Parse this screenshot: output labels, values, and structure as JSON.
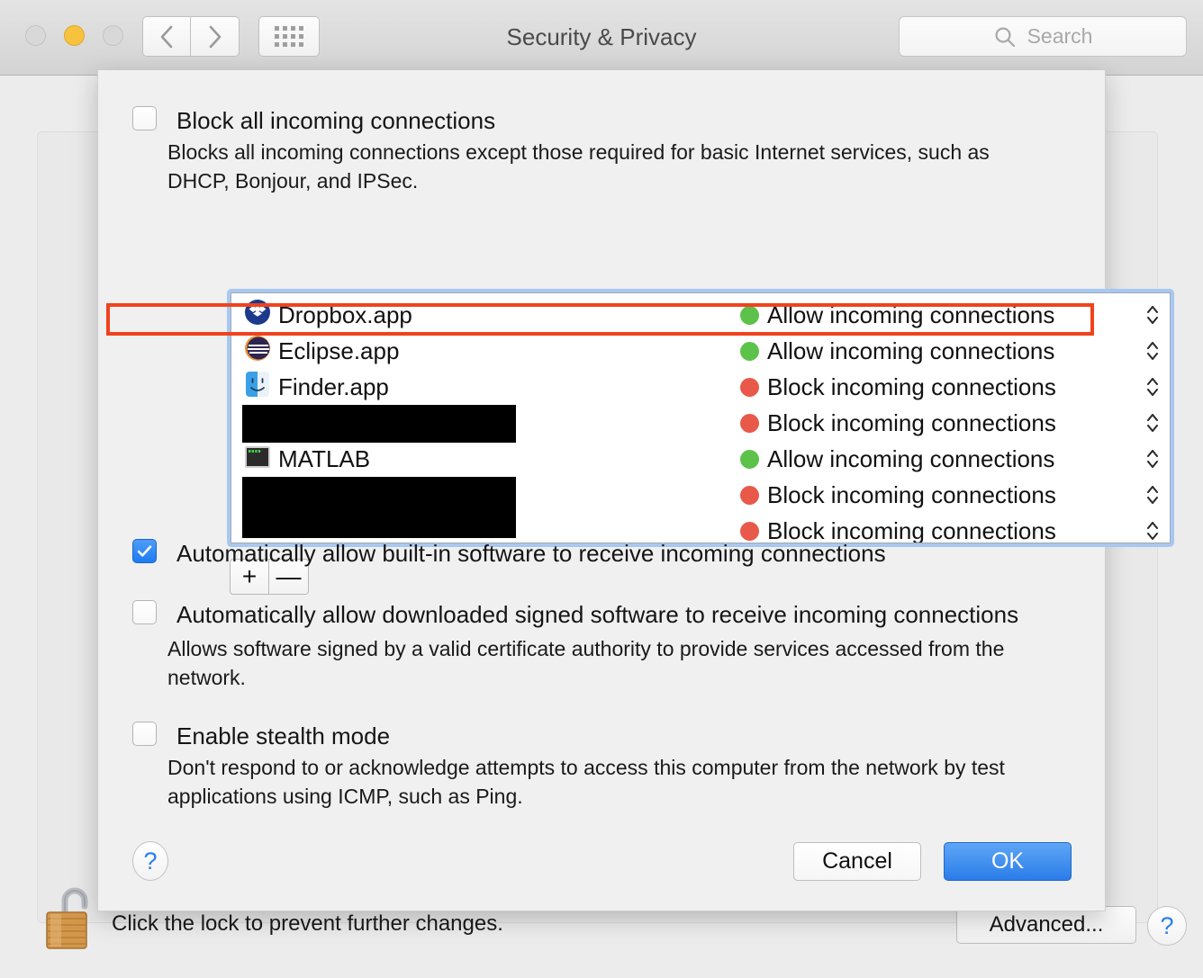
{
  "window": {
    "title": "Security & Privacy",
    "traffic_lights": [
      "close",
      "minimize",
      "zoom"
    ],
    "nav": {
      "back": "back-arrow",
      "forward": "forward-arrow",
      "show_all": "grid-icon"
    },
    "search": {
      "placeholder": "Search",
      "value": "",
      "icon": "search-icon"
    }
  },
  "background": {
    "lock_text": "Click the lock to prevent further changes.",
    "lock_icon": "unlocked-padlock-icon",
    "advanced_label": "Advanced...",
    "help_label": "?"
  },
  "sheet": {
    "block_all": {
      "label": "Block all incoming connections",
      "checked": false,
      "description": "Blocks all incoming connections except those required for basic Internet services,  such as DHCP, Bonjour, and IPSec."
    },
    "app_list": {
      "add_label": "+",
      "remove_label": "—",
      "rows": [
        {
          "name": "Dropbox.app",
          "icon": "dropbox-icon",
          "status": "Allow incoming connections",
          "state": "allow",
          "redacted": false
        },
        {
          "name": "Eclipse.app",
          "icon": "eclipse-icon",
          "status": "Allow incoming connections",
          "state": "allow",
          "redacted": false
        },
        {
          "name": "Finder.app",
          "icon": "finder-icon",
          "status": "Block incoming connections",
          "state": "block",
          "redacted": false,
          "highlighted": true
        },
        {
          "name": "",
          "icon": "",
          "status": "Block incoming connections",
          "state": "block",
          "redacted": true
        },
        {
          "name": "MATLAB",
          "icon": "matlab-icon",
          "status": "Allow incoming connections",
          "state": "allow",
          "redacted": false
        },
        {
          "name": "",
          "icon": "",
          "status": "Block incoming connections",
          "state": "block",
          "redacted": true
        },
        {
          "name": "",
          "icon": "",
          "status": "Block incoming connections",
          "state": "block",
          "redacted": true
        }
      ]
    },
    "auto_builtin": {
      "label": "Automatically allow built-in software to receive incoming connections",
      "checked": true
    },
    "auto_signed": {
      "label": "Automatically allow downloaded signed software to receive incoming connections",
      "checked": false,
      "description": "Allows software signed by a valid certificate authority to provide services accessed from the network."
    },
    "stealth": {
      "label": "Enable stealth mode",
      "checked": false,
      "description": "Don't respond to or acknowledge attempts to access this computer from the network by test applications using ICMP, such as Ping."
    },
    "footer": {
      "help_label": "?",
      "cancel_label": "Cancel",
      "ok_label": "OK"
    }
  },
  "colors": {
    "allow_dot": "#5dc24a",
    "block_dot": "#e8594a",
    "accent_blue": "#2a7ce9",
    "annotation_red": "#f0421d",
    "focus_ring": "#a8c8f0"
  }
}
